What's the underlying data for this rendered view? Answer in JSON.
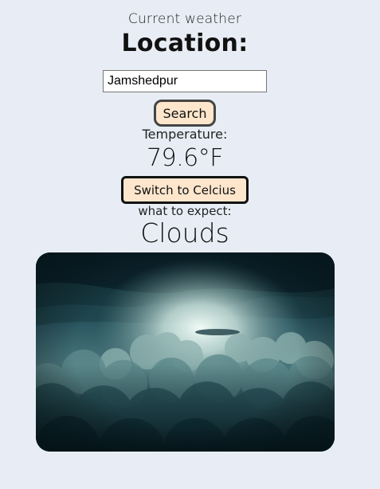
{
  "header": {
    "subtitle": "Current weather",
    "location_label": "Location:"
  },
  "search": {
    "value": "Jamshedpur",
    "button_label": "Search"
  },
  "temperature": {
    "label": "Temperature:",
    "value": "79.6°F",
    "switch_label": "Switch to Celcius"
  },
  "forecast": {
    "label": "what to expect:",
    "condition": "Clouds"
  },
  "image": {
    "icon": "clouds-photo",
    "colors": {
      "sky_dark": "#0d2b35",
      "sky_mid": "#3d6b74",
      "light": "#e8f3ef",
      "accent_button": "#fde6cc",
      "page_bg": "#e8edf5"
    }
  }
}
